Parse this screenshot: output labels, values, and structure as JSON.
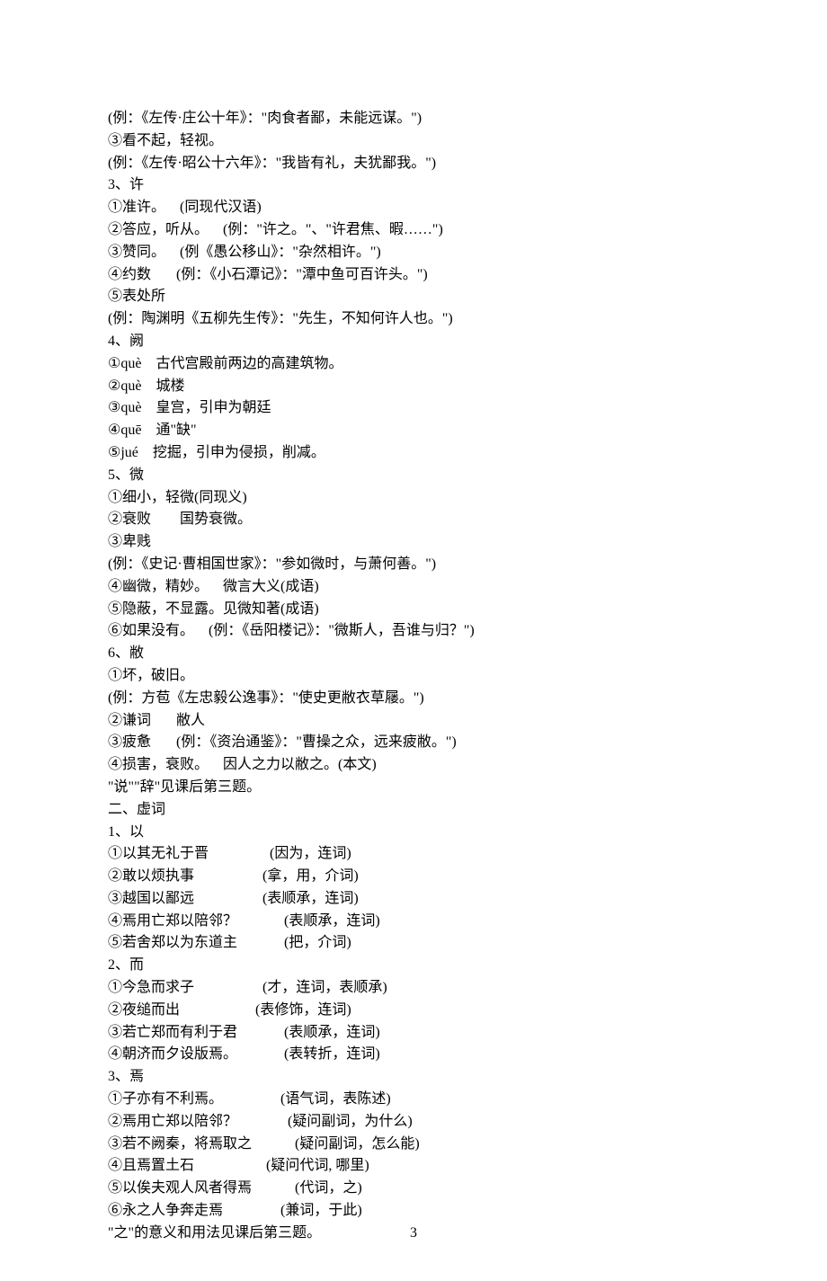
{
  "lines": [
    "(例：《左传·庄公十年》：\"肉食者鄙，未能远谋。\")",
    "③看不起，轻视。",
    "(例：《左传·昭公十六年》：\"我皆有礼，夫犹鄙我。\")",
    "3、许",
    "①准许。    (同现代汉语)",
    "②答应，听从。    (例：\"许之。\"、\"许君焦、暇……\")",
    "③赞同。    (例《愚公移山》：\"杂然相许。\")",
    "④约数       (例：《小石潭记》：\"潭中鱼可百许头。\")",
    "⑤表处所",
    "(例：陶渊明《五柳先生传》：\"先生，不知何许人也。\")",
    "4、阙",
    "①què    古代宫殿前两边的高建筑物。",
    "②què    城楼",
    "③què    皇宫，引申为朝廷",
    "④quē    通\"缺\"",
    "⑤jué    挖掘，引申为侵损，削减。",
    "5、微",
    "①细小，轻微(同现义)",
    "②衰败        国势衰微。",
    "③卑贱",
    "(例：《史记·曹相国世家》：\"参如微时，与萧何善。\")",
    "④幽微，精妙。    微言大义(成语)",
    "⑤隐蔽，不显露。见微知著(成语)",
    "⑥如果没有。    (例：《岳阳楼记》：\"微斯人，吾谁与归？\")",
    "6、敝",
    "①坏，破旧。",
    "(例：方苞《左忠毅公逸事》：\"使史更敝衣草屦。\")",
    "②谦词       敝人",
    "③疲惫       (例：《资治通鉴》：\"曹操之众，远来疲敝。\")",
    "④损害，衰败。    因人之力以敝之。(本文)",
    "\"说\"\"辞\"见课后第三题。",
    "二、虚词",
    "1、以",
    "①以其无礼于晋                 (因为，连词)",
    "②敢以烦执事                   (拿，用，介词)",
    "③越国以鄙远                   (表顺承，连词)",
    "④焉用亡郑以陪邻？             (表顺承，连词)",
    "⑤若舍郑以为东道主             (把，介词)",
    "2、而",
    "①今急而求子                   (才，连词，表顺承)",
    "②夜缒而出                     (表修饰，连词)",
    "③若亡郑而有利于君             (表顺承，连词)",
    "④朝济而夕设版焉。             (表转折，连词)",
    "3、焉",
    "①子亦有不利焉。                (语气词，表陈述)",
    "②焉用亡郑以陪邻？              (疑问副词，为什么)",
    "③若不阙秦，将焉取之            (疑问副词，怎么能)",
    "④且焉置土石                    (疑问代词, 哪里)",
    "⑤以俟夫观人风者得焉            (代词，之)",
    "⑥永之人争奔走焉                (兼词，于此)",
    "\"之\"的意义和用法见课后第三题。"
  ],
  "page_number": "3"
}
